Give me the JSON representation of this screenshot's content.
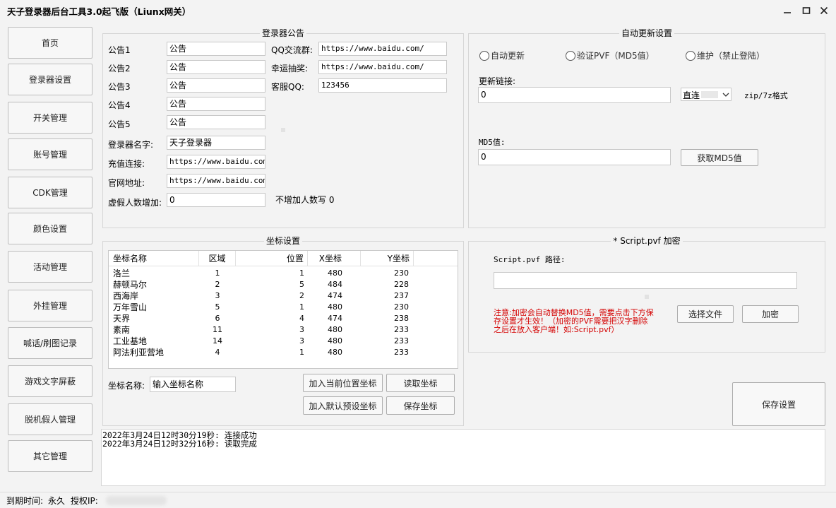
{
  "window": {
    "title": "天子登录器后台工具3.0起飞版（Liunx网关）",
    "controls": [
      "minimize-icon",
      "maximize-icon",
      "close-icon"
    ]
  },
  "nav": [
    "首页",
    "登录器设置",
    "开关管理",
    "账号管理",
    "CDK管理",
    "颜色设置",
    "活动管理",
    "外挂管理",
    "喊话/刷图记录",
    "游戏文字屏蔽",
    "脱机假人管理",
    "其它管理"
  ],
  "notice": {
    "title": "登录器公告",
    "labels": [
      "公告1",
      "公告2",
      "公告3",
      "公告4",
      "公告5"
    ],
    "values": [
      "公告",
      "公告",
      "公告",
      "公告",
      "公告"
    ],
    "qq_group_label": "QQ交流群:",
    "qq_group_value": "https://www.baidu.com/",
    "lottery_label": "幸运抽奖:",
    "lottery_value": "https://www.baidu.com/",
    "service_qq_label": "客服QQ:",
    "service_qq_value": "123456",
    "launcher_name_label": "登录器名字:",
    "launcher_name_value": "天子登录器",
    "recharge_label": "充值连接:",
    "recharge_value": "https://www.baidu.com/",
    "website_label": "官网地址:",
    "website_value": "https://www.baidu.com/",
    "fake_players_label": "虚假人数增加:",
    "fake_players_value": "0",
    "fake_players_hint": "不增加人数写 0"
  },
  "update": {
    "title": "自动更新设置",
    "radios": [
      "自动更新",
      "验证PVF（MD5值）",
      "维护（禁止登陆）"
    ],
    "link_label": "更新链接:",
    "link_value": "0",
    "mode_value": "直连",
    "format_hint": "zip/7z格式",
    "md5_label": "MD5值:",
    "md5_value": "0",
    "get_md5_button": "获取MD5值"
  },
  "coords": {
    "title": "坐标设置",
    "columns": [
      "坐标名称",
      "区域",
      "位置",
      "X坐标",
      "Y坐标"
    ],
    "rows": [
      [
        "洛兰",
        "1",
        "1",
        "480",
        "230"
      ],
      [
        "赫顿马尔",
        "2",
        "5",
        "484",
        "228"
      ],
      [
        "西海岸",
        "3",
        "2",
        "474",
        "237"
      ],
      [
        "万年雪山",
        "5",
        "1",
        "480",
        "230"
      ],
      [
        "天界",
        "6",
        "4",
        "474",
        "238"
      ],
      [
        "素南",
        "11",
        "3",
        "480",
        "233"
      ],
      [
        "工业基地",
        "14",
        "3",
        "480",
        "233"
      ],
      [
        "阿法利亚营地",
        "4",
        "1",
        "480",
        "233"
      ]
    ],
    "name_label": "坐标名称:",
    "name_placeholder": "输入坐标名称",
    "add_current_button": "加入当前位置坐标",
    "read_button": "读取坐标",
    "add_default_button": "加入默认预设坐标",
    "save_button": "保存坐标"
  },
  "script": {
    "title": "* Script.pvf 加密",
    "path_label": "Script.pvf 路径:",
    "path_value": "",
    "warning_line1": "注意:加密会自动替换MD5值，需要点击下方保",
    "warning_line2": "存设置才生效！（加密的PVF需要把汉字删除",
    "warning_line3": "之后在放入客户端！如:Script.pvf）",
    "choose_file_button": "选择文件",
    "encrypt_button": "加密"
  },
  "save_settings_button": "保存设置",
  "log": [
    "2022年3月24日12时30分19秒: 连接成功",
    "2022年3月24日12时32分16秒: 读取完成"
  ],
  "status": {
    "expire_label": "到期时间:",
    "expire_value": "永久",
    "ip_label": "授权IP:"
  }
}
